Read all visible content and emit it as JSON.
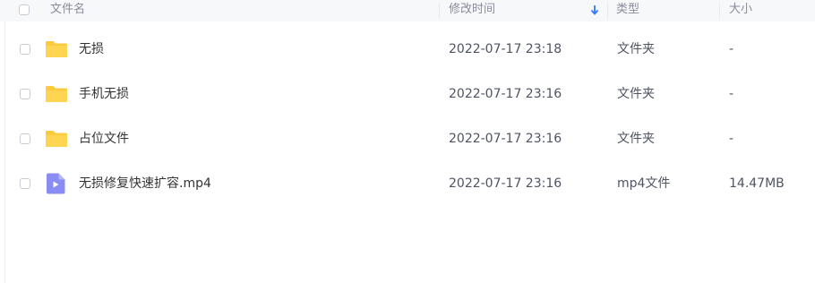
{
  "header": {
    "name": "文件名",
    "modified": "修改时间",
    "type": "类型",
    "size": "大小",
    "sort_icon": "arrow-down-icon",
    "sort_color": "#2f7cf6"
  },
  "files": [
    {
      "kind": "folder",
      "icon": "folder-icon",
      "name": "无损",
      "modified": "2022-07-17 23:18",
      "type": "文件夹",
      "size": "-"
    },
    {
      "kind": "folder",
      "icon": "folder-icon",
      "name": "手机无损",
      "modified": "2022-07-17 23:16",
      "type": "文件夹",
      "size": "-"
    },
    {
      "kind": "folder",
      "icon": "folder-icon",
      "name": "占位文件",
      "modified": "2022-07-17 23:16",
      "type": "文件夹",
      "size": "-"
    },
    {
      "kind": "video",
      "icon": "video-file-icon",
      "name": "无损修复快速扩容.mp4",
      "modified": "2022-07-17 23:16",
      "type": "mp4文件",
      "size": "14.47MB"
    }
  ],
  "colors": {
    "folder": "#fcca3f",
    "video": "#8a8cf6",
    "header_bg": "#f7f8fa"
  }
}
